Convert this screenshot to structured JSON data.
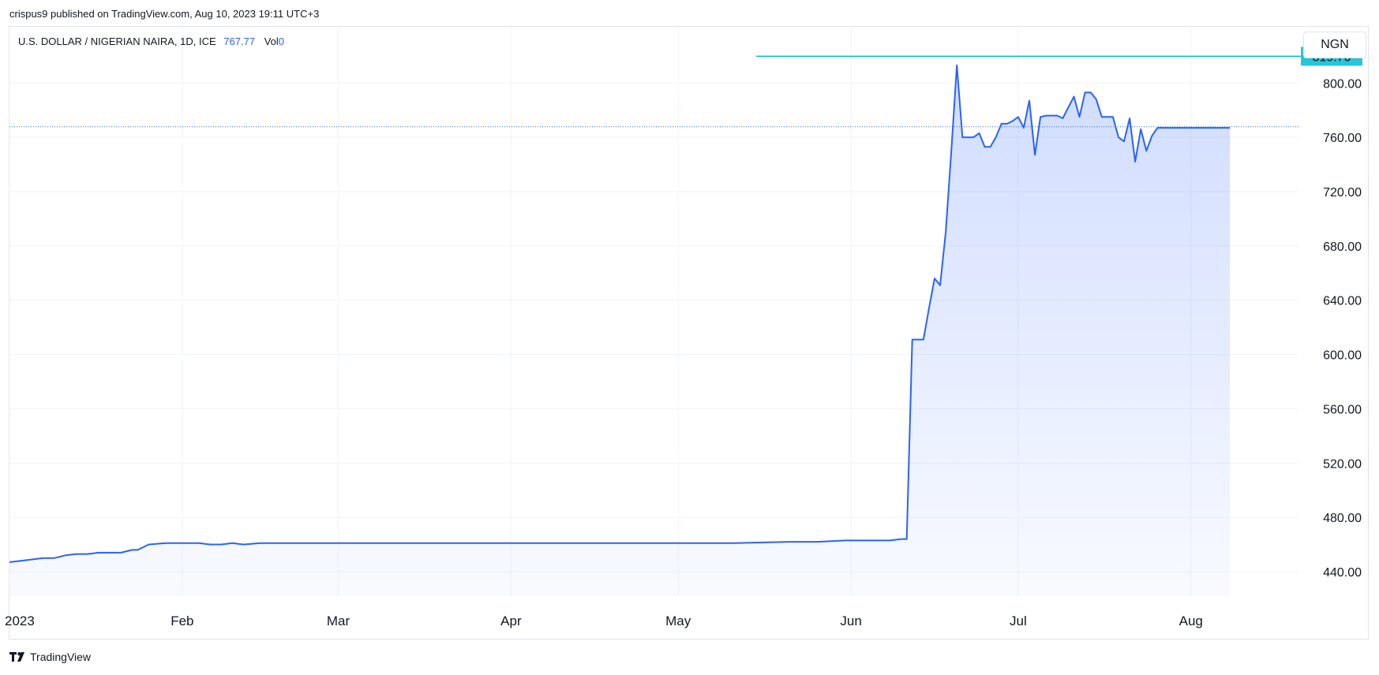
{
  "header": {
    "published": "crispus9 published on TradingView.com, Aug 10, 2023 19:11 UTC+3"
  },
  "legend": {
    "symbol": "U.S. DOLLAR / NIGERIAN NAIRA, 1D, ICE",
    "last": "767.77",
    "vol_label": "Vol",
    "vol_value": "0"
  },
  "currency_button": "NGN",
  "footer": {
    "brand": "TradingView"
  },
  "colors": {
    "line": "#2962ff",
    "level_line": "#00bcd4",
    "level_label_bg": "#26c6da",
    "grid": "#f0f3fa"
  },
  "chart_data": {
    "type": "area",
    "title": "U.S. DOLLAR / NIGERIAN NAIRA, 1D, ICE",
    "xlabel": "",
    "ylabel": "",
    "ylim": [
      415,
      835
    ],
    "y_ticks": [
      "440.00",
      "480.00",
      "520.00",
      "560.00",
      "600.00",
      "640.00",
      "680.00",
      "720.00",
      "760.00",
      "800.00"
    ],
    "x_ticks": [
      {
        "label": "2023",
        "day": 0
      },
      {
        "label": "Feb",
        "day": 31
      },
      {
        "label": "Mar",
        "day": 59
      },
      {
        "label": "Apr",
        "day": 90
      },
      {
        "label": "May",
        "day": 120
      },
      {
        "label": "Jun",
        "day": 151
      },
      {
        "label": "Jul",
        "day": 181
      },
      {
        "label": "Aug",
        "day": 212
      }
    ],
    "xlim_days": [
      0,
      233
    ],
    "last_value": 767.77,
    "horizontal_level": {
      "value": 819.7,
      "label": "819.70",
      "start_day": 134
    },
    "series": [
      {
        "name": "USD/NGN",
        "day": [
          0,
          2,
          4,
          6,
          8,
          10,
          12,
          14,
          16,
          18,
          20,
          22,
          23,
          25,
          28,
          31,
          34,
          36,
          38,
          40,
          42,
          45,
          50,
          60,
          70,
          80,
          90,
          100,
          110,
          120,
          130,
          140,
          145,
          150,
          155,
          158,
          160,
          161,
          162,
          164,
          165,
          166,
          167,
          168,
          169,
          170,
          171,
          172,
          173,
          174,
          175,
          176,
          177,
          178,
          179,
          180,
          181,
          182,
          183,
          184,
          185,
          186,
          187,
          188,
          189,
          190,
          191,
          192,
          193,
          194,
          195,
          196,
          197,
          198,
          199,
          200,
          201,
          202,
          203,
          204,
          205,
          206,
          207,
          208,
          209,
          210,
          211,
          212,
          213,
          214,
          215,
          216,
          217,
          218,
          219
        ],
        "values": [
          447,
          448,
          449,
          450,
          450,
          452,
          453,
          453,
          454,
          454,
          454,
          456,
          456,
          460,
          461,
          461,
          461,
          460,
          460,
          461,
          460,
          461,
          461,
          461,
          461,
          461,
          461,
          461,
          461,
          461,
          461,
          462,
          462,
          463,
          463,
          463,
          464,
          464,
          611,
          611,
          634,
          656,
          651,
          690,
          750,
          813,
          760,
          760,
          760,
          763,
          753,
          753,
          760,
          770,
          770,
          772,
          775,
          767,
          787,
          747,
          775,
          776,
          776,
          776,
          774,
          782,
          790,
          775,
          793,
          793,
          788,
          775,
          775,
          775,
          760,
          757,
          774,
          742,
          766,
          750,
          761,
          767,
          767,
          767,
          767,
          767,
          767,
          767,
          767,
          767,
          767,
          767,
          767,
          767,
          767
        ]
      }
    ]
  }
}
